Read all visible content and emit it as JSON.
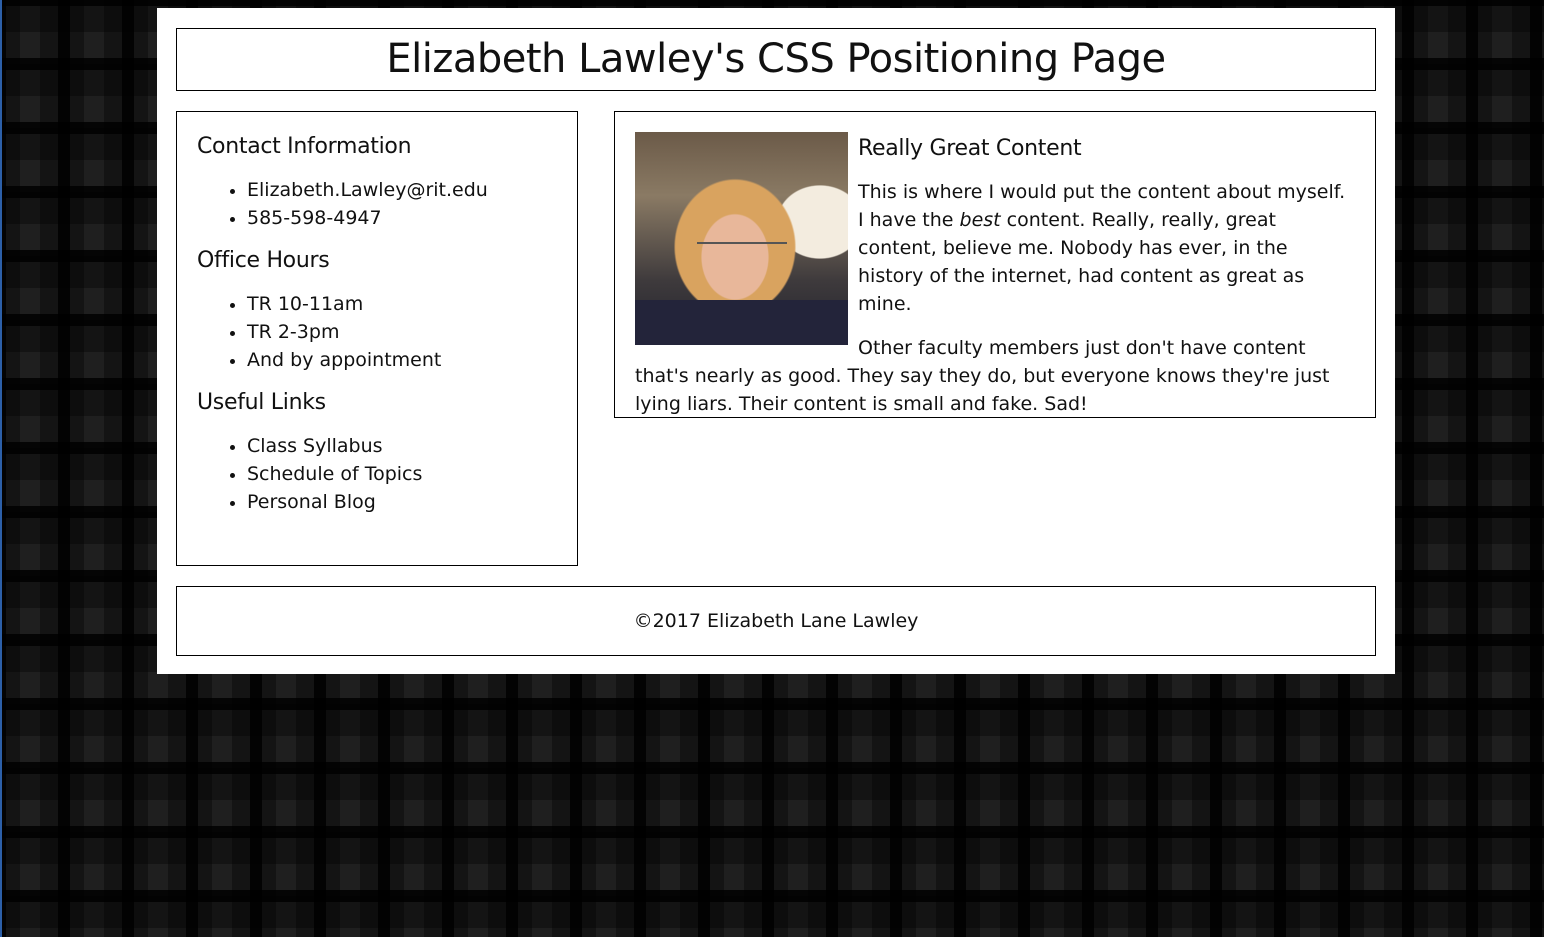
{
  "header": {
    "title": "Elizabeth Lawley's CSS Positioning Page"
  },
  "sidebar": {
    "contact": {
      "heading": "Contact Information",
      "items": [
        "Elizabeth.Lawley@rit.edu",
        "585-598-4947"
      ]
    },
    "office_hours": {
      "heading": "Office Hours",
      "items": [
        "TR 10-11am",
        "TR 2-3pm",
        "And by appointment"
      ]
    },
    "links": {
      "heading": "Useful Links",
      "items": [
        "Class Syllabus",
        "Schedule of Topics",
        "Personal Blog"
      ]
    }
  },
  "main": {
    "heading": "Really Great Content",
    "p1_before": "This is where I would put the content about myself. I have the ",
    "p1_emphasis": "best",
    "p1_after": " content. Really, really, great content, believe me. Nobody has ever, in the history of the internet, had content as great as mine.",
    "p2": "Other faculty members just don't have content that's nearly as good. They say they do, but everyone knows they're just lying liars. Their content is small and fake. Sad!"
  },
  "footer": {
    "text": "©2017 Elizabeth Lane Lawley"
  }
}
